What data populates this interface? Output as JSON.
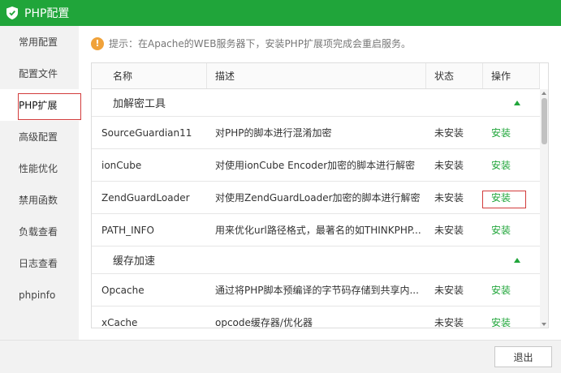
{
  "window": {
    "title": "PHP配置"
  },
  "sidebar": {
    "items": [
      {
        "label": "常用配置"
      },
      {
        "label": "配置文件"
      },
      {
        "label": "PHP扩展"
      },
      {
        "label": "高级配置"
      },
      {
        "label": "性能优化"
      },
      {
        "label": "禁用函数"
      },
      {
        "label": "负载查看"
      },
      {
        "label": "日志查看"
      },
      {
        "label": "phpinfo"
      }
    ],
    "active": "PHP扩展"
  },
  "notice": {
    "text": "提示：在Apache的WEB服务器下，安装PHP扩展项完成会重启服务。"
  },
  "table": {
    "headers": {
      "name": "名称",
      "desc": "描述",
      "status": "状态",
      "op": "操作"
    },
    "groups": [
      {
        "label": "加解密工具",
        "rows": [
          {
            "name": "SourceGuardian11",
            "desc": "对PHP的脚本进行混淆加密",
            "status": "未安装",
            "op": "安装"
          },
          {
            "name": "ionCube",
            "desc": "对使用ionCube Encoder加密的脚本进行解密",
            "status": "未安装",
            "op": "安装"
          },
          {
            "name": "ZendGuardLoader",
            "desc": "对使用ZendGuardLoader加密的脚本进行解密",
            "status": "未安装",
            "op": "安装"
          },
          {
            "name": "PATH_INFO",
            "desc": "用来优化url路径格式，最著名的如THINKPHP...",
            "status": "未安装",
            "op": "安装"
          }
        ]
      },
      {
        "label": "缓存加速",
        "rows": [
          {
            "name": "Opcache",
            "desc": "通过将PHP脚本预编译的字节码存储到共享内...",
            "status": "未安装",
            "op": "安装"
          },
          {
            "name": "xCache",
            "desc": "opcode缓存器/优化器",
            "status": "未安装",
            "op": "安装"
          }
        ]
      }
    ]
  },
  "footer": {
    "exit_label": "退出"
  },
  "colors": {
    "brand": "#20a53a",
    "highlight": "#d23b3b",
    "notice": "#f0a23a"
  }
}
